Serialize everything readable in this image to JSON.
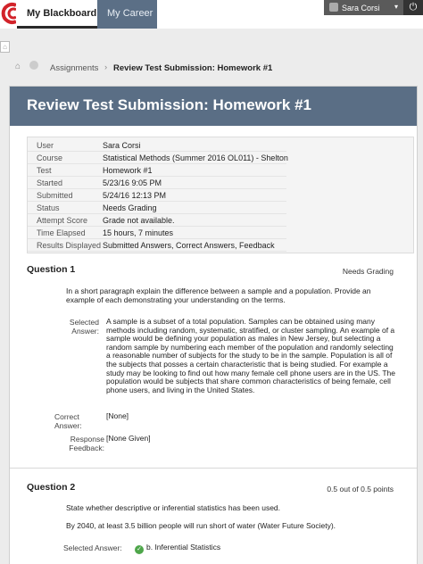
{
  "nav": {
    "tab_active": "My Blackboard",
    "tab_other": "My Career",
    "user_name": "Sara Corsi",
    "power_icon": "power-icon"
  },
  "breadcrumb": {
    "item1": "Assignments",
    "item2": "Review Test Submission: Homework #1"
  },
  "page": {
    "title": "Review Test Submission: Homework #1"
  },
  "info": [
    {
      "label": "User",
      "value": "Sara Corsi"
    },
    {
      "label": "Course",
      "value": "Statistical Methods (Summer 2016 OL011) - Shelton"
    },
    {
      "label": "Test",
      "value": "Homework #1"
    },
    {
      "label": "Started",
      "value": "5/23/16 9:05 PM"
    },
    {
      "label": "Submitted",
      "value": "5/24/16 12:13 PM"
    },
    {
      "label": "Status",
      "value": "Needs Grading"
    },
    {
      "label": "Attempt Score",
      "value": "Grade not available."
    },
    {
      "label": "Time Elapsed",
      "value": "15 hours, 7 minutes"
    },
    {
      "label": "Results Displayed",
      "value": "Submitted Answers, Correct Answers, Feedback"
    }
  ],
  "q1": {
    "title": "Question 1",
    "status": "Needs Grading",
    "prompt": "In a short paragraph explain the difference between a sample and a population. Provide an example of each demonstrating your understanding on the terms.",
    "selected_label": "Selected Answer:",
    "selected_answer": "A sample is a subset of a total population. Samples can be obtained using many methods including random, systematic, stratified, or cluster sampling. An example of a sample would be defining your population as males in New Jersey, but selecting a random sample by numbering each member of the population and randomly selecting a reasonable number of subjects for the study to be in the sample.  Population is all of the subjects that posses a certain characteristic that is being studied. For example a study may be looking to find out how many female cell phone users are in the US. The population would be subjects that share common characteristics of being female, cell phone users, and living in the United States.",
    "correct_label": "Correct Answer:",
    "correct_answer": "[None]",
    "feedback_label": "Response Feedback:",
    "feedback": "[None Given]"
  },
  "q2": {
    "title": "Question 2",
    "status": "0.5 out of 0.5 points",
    "prompt": "State whether descriptive or inferential statistics has been used.",
    "prompt2": "By 2040, at least 3.5 billion people will run short of water (Water Future Society).",
    "selected_label": "Selected Answer:",
    "selected_answer": "b. Inferential Statistics"
  }
}
